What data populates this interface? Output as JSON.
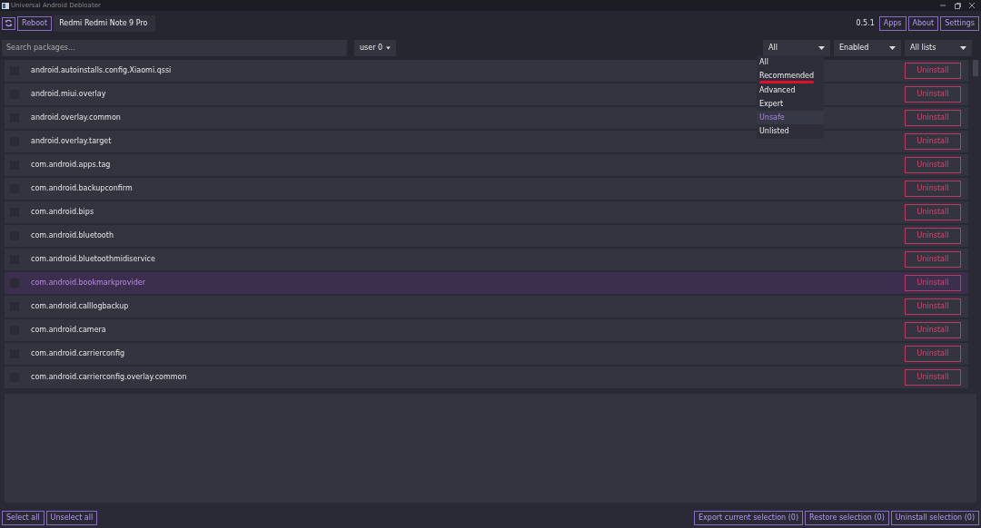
{
  "window": {
    "title": "Universal Android Debloater"
  },
  "toolbar": {
    "reboot": "Reboot",
    "device": "Redmi Redmi Note 9 Pro",
    "version": "0.5.1",
    "buttons": [
      "Apps",
      "About",
      "Settings"
    ]
  },
  "filters": {
    "search": {
      "placeholder": "Search packages..."
    },
    "user": "user 0",
    "removal": "All",
    "state": "Enabled",
    "list": "All lists",
    "removal_menu": [
      {
        "label": "All",
        "hovered": false,
        "underlined": false
      },
      {
        "label": "Recommended",
        "hovered": false,
        "underlined": true
      },
      {
        "label": "Advanced",
        "hovered": false,
        "underlined": false
      },
      {
        "label": "Expert",
        "hovered": false,
        "underlined": false
      },
      {
        "label": "Unsafe",
        "hovered": true,
        "underlined": false
      },
      {
        "label": "Unlisted",
        "hovered": false,
        "underlined": false
      }
    ]
  },
  "packages": [
    {
      "name": "android.autoinstalls.config.Xiaomi.qssi",
      "checked": false,
      "selected": false,
      "action": "Uninstall"
    },
    {
      "name": "android.miui.overlay",
      "checked": false,
      "selected": false,
      "action": "Uninstall"
    },
    {
      "name": "android.overlay.common",
      "checked": false,
      "selected": false,
      "action": "Uninstall"
    },
    {
      "name": "android.overlay.target",
      "checked": false,
      "selected": false,
      "action": "Uninstall"
    },
    {
      "name": "com.android.apps.tag",
      "checked": false,
      "selected": false,
      "action": "Uninstall"
    },
    {
      "name": "com.android.backupconfirm",
      "checked": false,
      "selected": false,
      "action": "Uninstall"
    },
    {
      "name": "com.android.bips",
      "checked": false,
      "selected": false,
      "action": "Uninstall"
    },
    {
      "name": "com.android.bluetooth",
      "checked": false,
      "selected": false,
      "action": "Uninstall"
    },
    {
      "name": "com.android.bluetoothmidiservice",
      "checked": false,
      "selected": false,
      "action": "Uninstall"
    },
    {
      "name": "com.android.bookmarkprovider",
      "checked": false,
      "selected": true,
      "action": "Uninstall"
    },
    {
      "name": "com.android.calllogbackup",
      "checked": false,
      "selected": false,
      "action": "Uninstall"
    },
    {
      "name": "com.android.camera",
      "checked": false,
      "selected": false,
      "action": "Uninstall"
    },
    {
      "name": "com.android.carrierconfig",
      "checked": false,
      "selected": false,
      "action": "Uninstall"
    },
    {
      "name": "com.android.carrierconfig.overlay.common",
      "checked": false,
      "selected": false,
      "action": "Uninstall"
    }
  ],
  "footer": {
    "left": [
      "Select all",
      "Unselect all"
    ],
    "right": [
      "Export current selection (0)",
      "Restore selection (0)",
      "Uninstall selection (0)"
    ]
  }
}
